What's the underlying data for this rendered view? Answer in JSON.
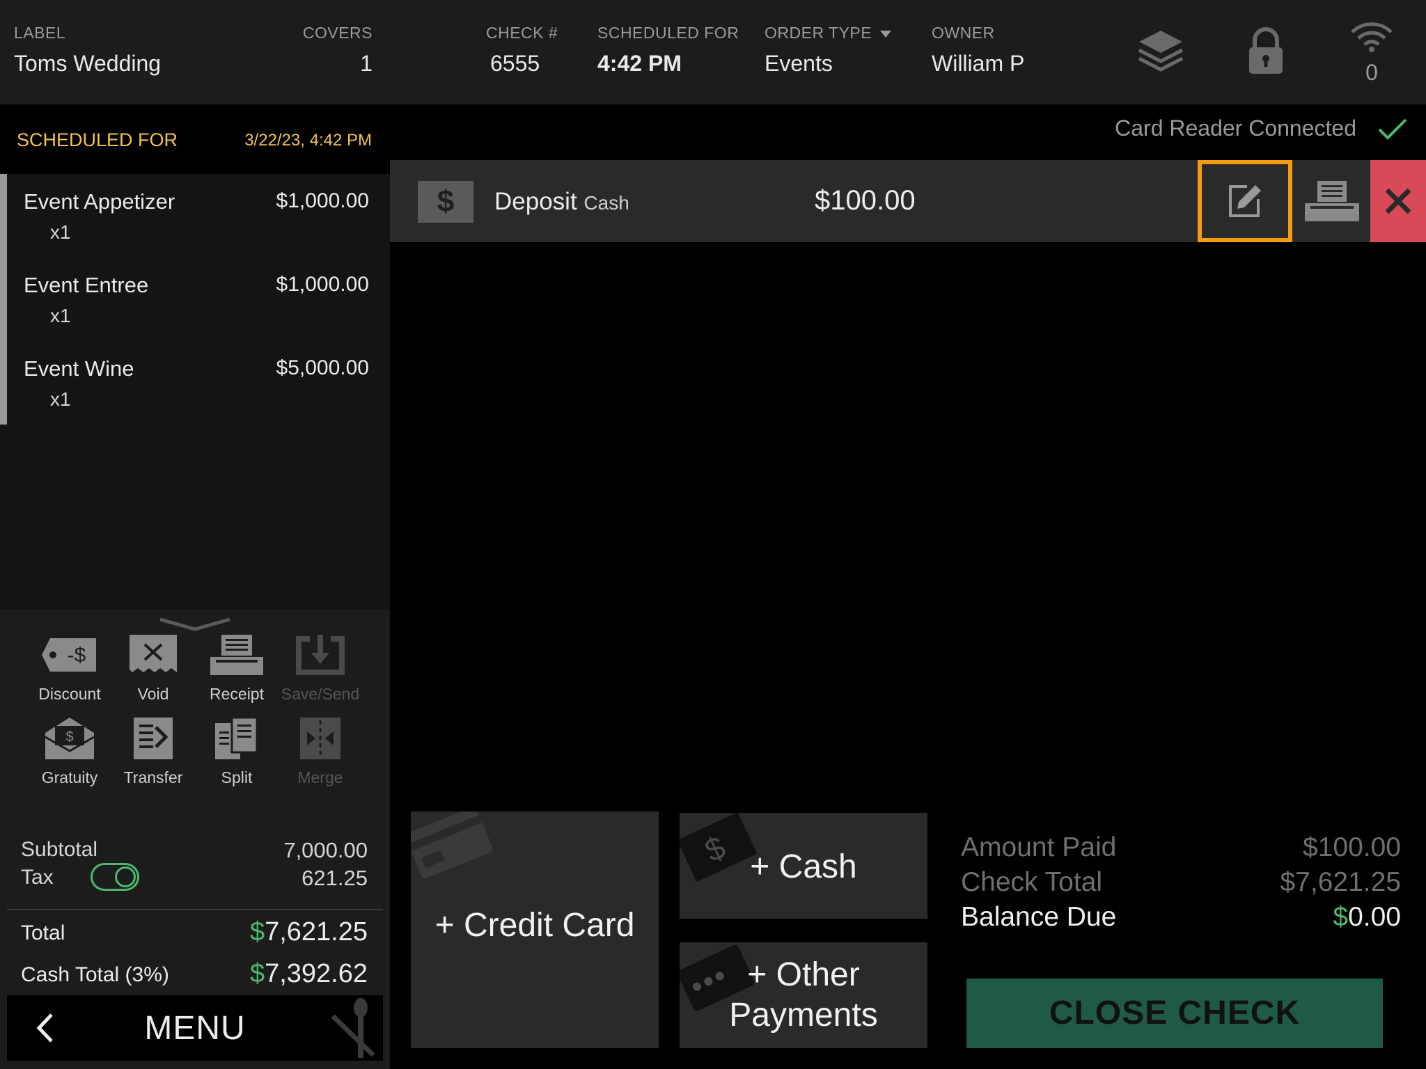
{
  "header": {
    "label_title": "LABEL",
    "label_value": "Toms Wedding",
    "covers_title": "COVERS",
    "covers_value": "1",
    "check_title": "CHECK #",
    "check_value": "6555",
    "scheduled_title": "SCHEDULED FOR",
    "scheduled_value": "4:42 PM",
    "order_type_title": "ORDER TYPE",
    "order_type_value": "Events",
    "owner_title": "OWNER",
    "owner_value": "William P",
    "wifi_count": "0",
    "icons": [
      "layers-icon",
      "lock-icon",
      "wifi-icon"
    ]
  },
  "left": {
    "scheduled_label": "SCHEDULED FOR",
    "scheduled_date": "3/22/23, 4:42 PM",
    "items": [
      {
        "name": "Event Appetizer",
        "qty": "x1",
        "price": "$1,000.00"
      },
      {
        "name": "Event Entree",
        "qty": "x1",
        "price": "$1,000.00"
      },
      {
        "name": "Event Wine",
        "qty": "x1",
        "price": "$5,000.00"
      }
    ],
    "actions": [
      {
        "label": "Discount",
        "icon": "discount-tag-icon",
        "enabled": true
      },
      {
        "label": "Void",
        "icon": "void-receipt-icon",
        "enabled": true
      },
      {
        "label": "Receipt",
        "icon": "receipt-printer-icon",
        "enabled": true
      },
      {
        "label": "Save/Send",
        "icon": "save-send-icon",
        "enabled": false
      },
      {
        "label": "Gratuity",
        "icon": "gratuity-envelope-icon",
        "enabled": true
      },
      {
        "label": "Transfer",
        "icon": "transfer-icon",
        "enabled": true
      },
      {
        "label": "Split",
        "icon": "split-icon",
        "enabled": true
      },
      {
        "label": "Merge",
        "icon": "merge-icon",
        "enabled": false
      }
    ],
    "subtotal_label": "Subtotal",
    "subtotal_value": "7,000.00",
    "tax_label": "Tax",
    "tax_value": "621.25",
    "tax_enabled": true,
    "total_label": "Total",
    "total_value": "7,621.25",
    "cash_total_label": "Cash Total (3%)",
    "cash_total_value": "7,392.62",
    "currency_symbol": "$",
    "menu_label": "MENU"
  },
  "right": {
    "card_reader_status": "Card Reader Connected",
    "payment": {
      "icon_symbol": "$",
      "name": "Deposit",
      "method": "Cash",
      "amount": "$100.00"
    },
    "buttons": {
      "credit_card": "+ Credit Card",
      "cash": "+ Cash",
      "other_line1": "+ Other",
      "other_line2": "Payments"
    },
    "summary": {
      "amount_paid_label": "Amount Paid",
      "amount_paid_value": "$100.00",
      "check_total_label": "Check Total",
      "check_total_value": "$7,621.25",
      "balance_due_label": "Balance Due",
      "balance_due_value": "0.00",
      "currency_symbol": "$"
    },
    "close_check_label": "CLOSE CHECK"
  },
  "colors": {
    "accent_yellow": "#f2c14e",
    "green": "#4db870",
    "highlight_orange": "#f39c12",
    "delete_red": "#d84a5a",
    "close_button": "#1f5a45"
  }
}
